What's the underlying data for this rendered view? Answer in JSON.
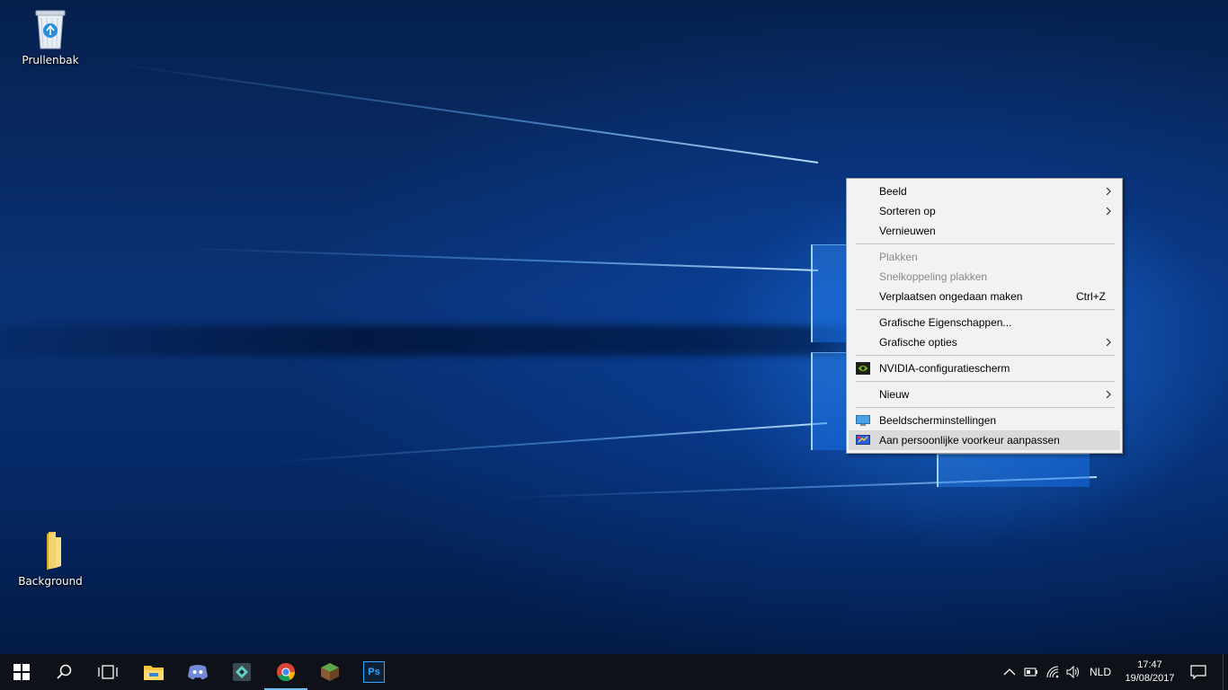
{
  "desktop": {
    "icons": [
      {
        "label": "Prullenbak",
        "icon": "recycle-bin-icon"
      },
      {
        "label": "Background",
        "icon": "folder-icon"
      }
    ]
  },
  "context_menu": {
    "items": [
      {
        "label": "Beeld",
        "submenu": true,
        "enabled": true
      },
      {
        "label": "Sorteren op",
        "submenu": true,
        "enabled": true
      },
      {
        "label": "Vernieuwen",
        "enabled": true
      },
      {
        "label": "Plakken",
        "enabled": false
      },
      {
        "label": "Snelkoppeling plakken",
        "enabled": false
      },
      {
        "label": "Verplaatsen ongedaan maken",
        "shortcut": "Ctrl+Z",
        "enabled": true
      },
      {
        "label": "Grafische Eigenschappen...",
        "enabled": true
      },
      {
        "label": "Grafische opties",
        "submenu": true,
        "enabled": true
      },
      {
        "label": "NVIDIA-configuratiescherm",
        "icon": "nvidia-icon",
        "enabled": true
      },
      {
        "label": "Nieuw",
        "submenu": true,
        "enabled": true
      },
      {
        "label": "Beeldscherminstellingen",
        "icon": "display-icon",
        "enabled": true
      },
      {
        "label": "Aan persoonlijke voorkeur aanpassen",
        "icon": "personalize-icon",
        "enabled": true,
        "highlighted": true
      }
    ]
  },
  "taskbar": {
    "buttons": [
      {
        "icon": "windows-start-icon"
      },
      {
        "icon": "search-icon"
      },
      {
        "icon": "task-view-icon"
      },
      {
        "icon": "file-explorer-icon"
      },
      {
        "icon": "discord-icon"
      },
      {
        "icon": "filmora-icon"
      },
      {
        "icon": "chrome-icon",
        "active": true
      },
      {
        "icon": "minecraft-icon"
      },
      {
        "icon": "photoshop-icon",
        "text": "Ps"
      }
    ],
    "tray": {
      "icons": [
        "chevron-up-icon",
        "battery-icon",
        "wifi-icon",
        "volume-icon"
      ],
      "language": "NLD",
      "time": "17:47",
      "date": "19/08/2017",
      "notification_icon": "action-center-icon"
    }
  }
}
